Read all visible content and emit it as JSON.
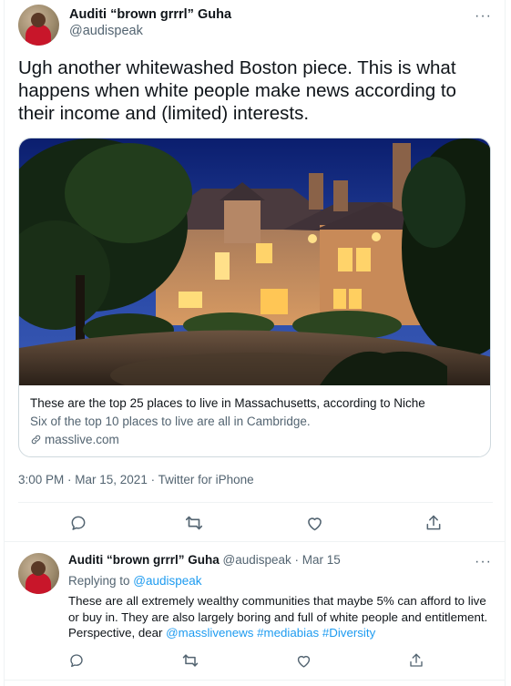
{
  "main_tweet": {
    "author_name": "Auditi “brown grrrl” Guha",
    "handle": "@audispeak",
    "more_label": "···",
    "text": "Ugh another whitewashed Boston piece. This is what happens when white people make news according to their income and (limited) interests.",
    "card": {
      "title": "These are the top 25 places to live in Massachusetts, according to Niche",
      "description": "Six of the top 10 places to live are all in Cambridge.",
      "domain": "masslive.com"
    },
    "timestamp": "3:00 PM · Mar 15, 2021 · Twitter for iPhone"
  },
  "actions": [
    "reply-icon",
    "retweet-icon",
    "like-icon",
    "share-icon"
  ],
  "reply_tweet": {
    "author_name": "Auditi “brown grrrl” Guha",
    "handle_date": "@audispeak · Mar 15",
    "more_label": "···",
    "replying_prefix": "Replying to ",
    "replying_handle": "@audispeak",
    "text_main": "These are all extremely wealthy communities that maybe 5% can afford to live or buy in. They are also largely boring and full of white people and entitlement. Perspective, dear ",
    "mention": "@masslivenews",
    "hashtag1": "#mediabias",
    "hashtag2": "#Diversity"
  },
  "colors": {
    "text": "#0f1419",
    "secondary": "#536471",
    "link": "#1d9bf0",
    "border": "#cfd9de",
    "divider": "#eff3f4"
  }
}
